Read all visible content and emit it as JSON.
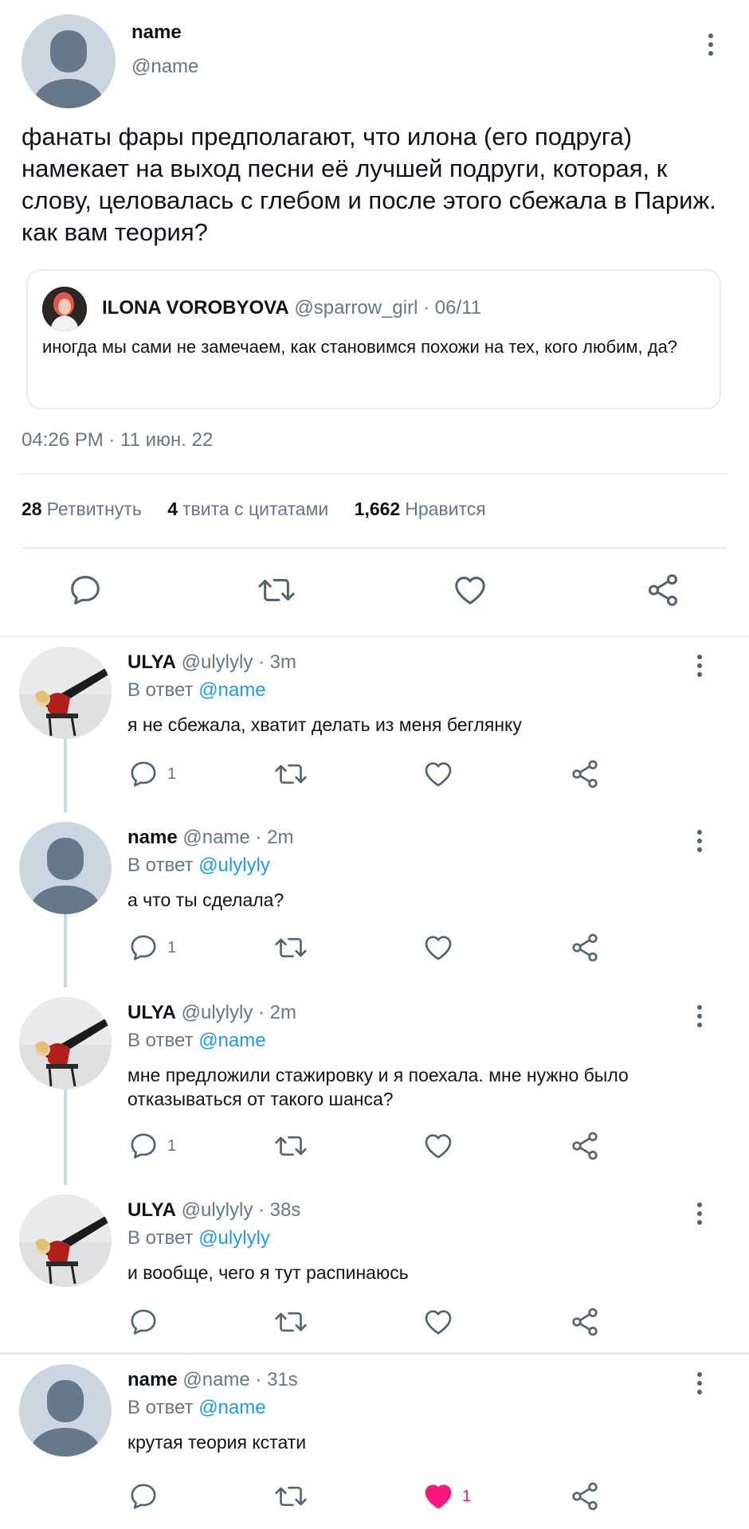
{
  "main_tweet": {
    "name": "name",
    "handle": "@name",
    "text": "фанаты фары предполагают, что илона (его подруга) намекает на выход песни её лучшей подруги, которая, к слову, целовалась с глебом  и после этого сбежала в Париж. как вам теория?",
    "quote": {
      "name": "ILONA VOROBYOVA",
      "handle_date": "@sparrow_girl · 06/11",
      "text": "иногда мы сами не замечаем, как становимся похожи на тех, кого любим, да?"
    },
    "timestamp": "04:26 PM · 11 июн. 22",
    "stats": {
      "retweets_count": "28",
      "retweets_label": "Ретвитнуть",
      "quotes_count": "4",
      "quotes_label": "твита с цитатами",
      "likes_count": "1,662",
      "likes_label": "Нравится"
    },
    "icons": [
      "reply-icon",
      "retweet-icon",
      "like-icon",
      "share-icon",
      "more-icon"
    ]
  },
  "replies": [
    {
      "name": "ULYA",
      "handle_time": "@ulylyly · 3m",
      "reply_prefix": "В ответ",
      "reply_to": "@name",
      "text": "я не сбежала, хватит делать из меня беглянку",
      "reply_count": "1",
      "like_count": ""
    },
    {
      "name": "name",
      "handle_time": "@name · 2m",
      "reply_prefix": "В ответ",
      "reply_to": "@ulylyly",
      "text": "а что ты сделала?",
      "reply_count": "1",
      "like_count": ""
    },
    {
      "name": "ULYA",
      "handle_time": "@ulylyly · 2m",
      "reply_prefix": "В ответ",
      "reply_to": "@name",
      "text": "мне предложили стажировку и я поехала. мне нужно было отказываться от такого шанса?",
      "reply_count": "1",
      "like_count": ""
    },
    {
      "name": "ULYA",
      "handle_time": "@ulylyly · 38s",
      "reply_prefix": "В ответ",
      "reply_to": "@ulylyly",
      "text": "и вообще, чего я тут распинаюсь",
      "reply_count": "",
      "like_count": ""
    },
    {
      "name": "name",
      "handle_time": "@name · 31s",
      "reply_prefix": "В ответ",
      "reply_to": "@name",
      "text": "крутая теория кстати",
      "reply_count": "",
      "like_count": "1",
      "liked": true
    }
  ],
  "colors": {
    "text": "#0f1419",
    "secondary": "#687684",
    "link": "#1d9bf0",
    "like": "#f91880",
    "border": "#e6ecf0"
  }
}
